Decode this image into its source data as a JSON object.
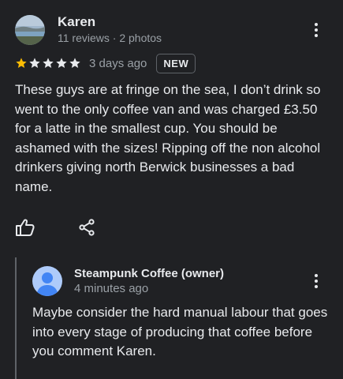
{
  "review": {
    "author_name": "Karen",
    "author_meta": "11 reviews · 2 photos",
    "rating": 1,
    "rating_max": 5,
    "date": "3 days ago",
    "badge": "NEW",
    "text": "These guys are at fringe on the sea, I don’t drink so went to the only coffee van and was charged £3.50 for a latte in the smallest cup. You should be ashamed with the sizes! Ripping off the non alcohol drinkers giving north Berwick businesses a bad name.",
    "actions": {
      "like_icon": "thumbs-up-icon",
      "share_icon": "share-icon"
    }
  },
  "owner_reply": {
    "owner_name": "Steampunk Coffee (owner)",
    "time": "4 minutes ago",
    "text": "Maybe consider the hard manual labour that goes into every stage of producing that coffee before you comment Karen.",
    "avatar_icon": "person-icon"
  },
  "colors": {
    "background": "#202124",
    "text_primary": "#e8eaed",
    "text_secondary": "#9aa0a6",
    "star_filled": "#fbbc04",
    "star_empty": "#e8eaed",
    "divider": "#5f6368",
    "owner_avatar_bg": "#aecbfa",
    "owner_avatar_fg": "#4285f4"
  }
}
